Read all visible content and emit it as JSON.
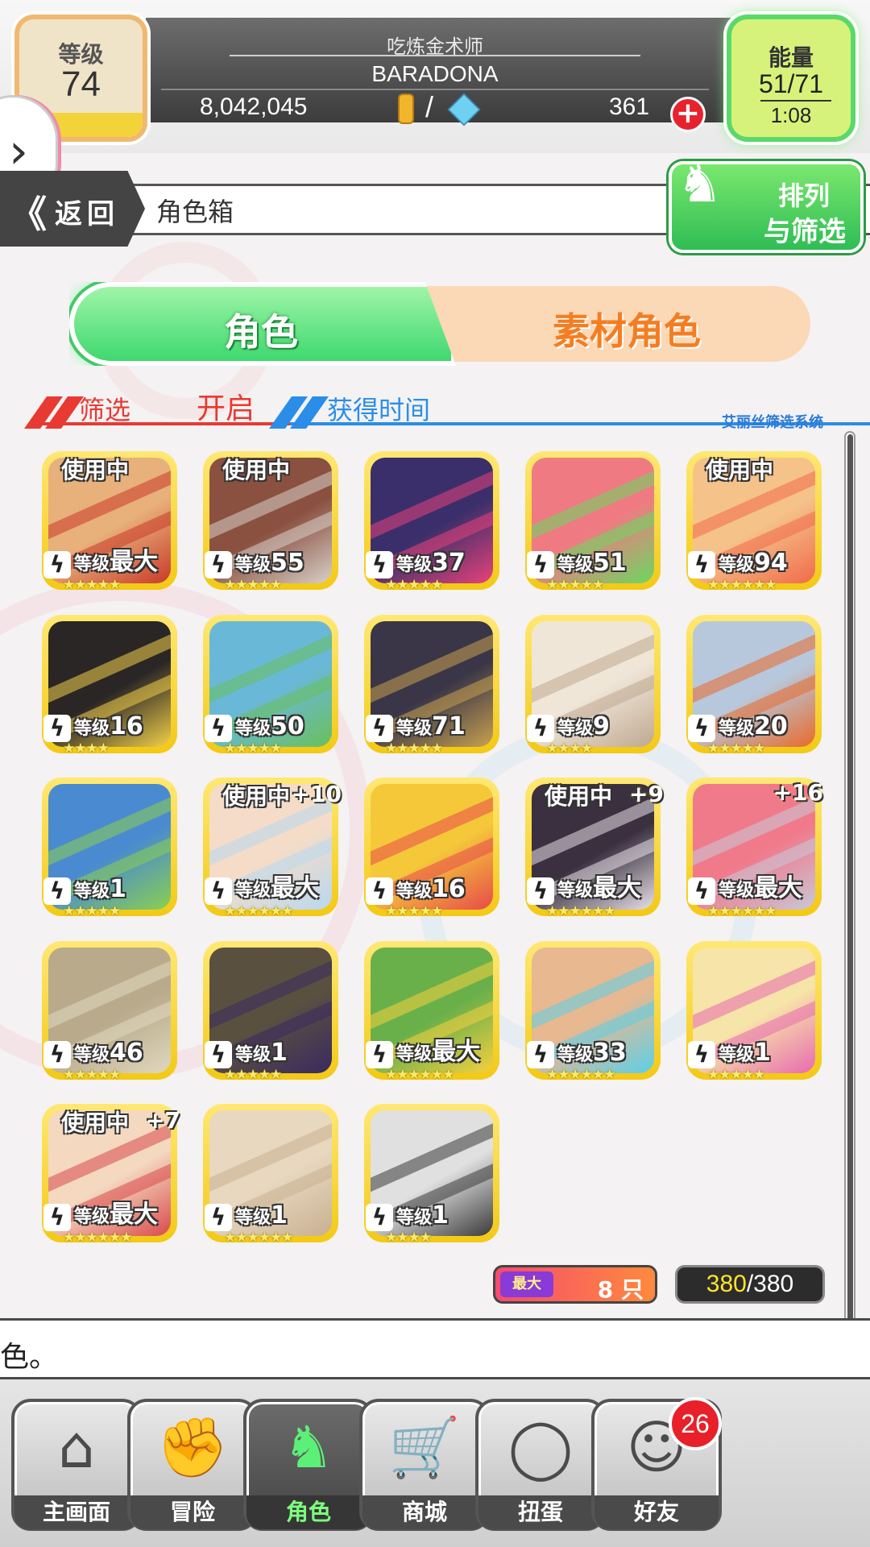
{
  "header": {
    "level_label": "等级",
    "level_value": "74",
    "title": "吃炼金术师",
    "player_name": "BARADONA",
    "gold": "8,042,045",
    "separator": "/",
    "gems": "361",
    "energy_label": "能量",
    "energy_value": "51/71",
    "energy_timer": "1:08",
    "add_icon": "plus-circle-icon"
  },
  "nav": {
    "back_label": "返回",
    "back_arrow": "《",
    "title": "角色箱",
    "sort_line1": "排列",
    "sort_line2": "与筛选"
  },
  "tabs": {
    "active": "角色",
    "inactive": "素材角色"
  },
  "filter": {
    "label": "筛选",
    "state": "开启",
    "sort_by": "获得时间",
    "system_name": "艾丽丝筛选系统"
  },
  "cards": [
    {
      "badge": "使用中",
      "level_prefix": "等级",
      "level": "最大",
      "stars": 5,
      "bg": "#e8b07a",
      "accent": "#c83a2a"
    },
    {
      "badge": "使用中",
      "level_prefix": "等级",
      "level": "55",
      "stars": 5,
      "bg": "#8a5040",
      "accent": "#d8d0c8"
    },
    {
      "badge": "",
      "level_prefix": "等级",
      "level": "37",
      "stars": 5,
      "bg": "#3a2f6a",
      "accent": "#e8427a"
    },
    {
      "badge": "",
      "level_prefix": "等级",
      "level": "51",
      "stars": 5,
      "bg": "#f07a82",
      "accent": "#6ad860"
    },
    {
      "badge": "使用中",
      "level_prefix": "等级",
      "level": "94",
      "stars": 6,
      "bg": "#f5c28a",
      "accent": "#f06a4a"
    },
    {
      "badge": "",
      "level_prefix": "等级",
      "level": "16",
      "stars": 4,
      "bg": "#2a2626",
      "accent": "#f2d04a"
    },
    {
      "badge": "",
      "level_prefix": "等级",
      "level": "50",
      "stars": 5,
      "bg": "#6ab8d8",
      "accent": "#6ac05a"
    },
    {
      "badge": "",
      "level_prefix": "等级",
      "level": "71",
      "stars": 5,
      "bg": "#3a3648",
      "accent": "#c8a050"
    },
    {
      "badge": "",
      "level_prefix": "等级",
      "level": "9",
      "stars": 4,
      "bg": "#efe6d8",
      "accent": "#c0a890"
    },
    {
      "badge": "",
      "level_prefix": "等级",
      "level": "20",
      "stars": 5,
      "bg": "#b8c8dc",
      "accent": "#e86a2a"
    },
    {
      "badge": "",
      "level_prefix": "等级",
      "level": "1",
      "stars": 5,
      "bg": "#4a8ad0",
      "accent": "#8ad050"
    },
    {
      "badge": "使用中",
      "plus": "+10",
      "level_prefix": "等级",
      "level": "最大",
      "stars": 6,
      "bg": "#f4dcc8",
      "accent": "#b8d8f0"
    },
    {
      "badge": "",
      "level_prefix": "等级",
      "level": "16",
      "stars": 5,
      "bg": "#f5c83a",
      "accent": "#e84a4a"
    },
    {
      "badge": "使用中",
      "plus": "+9",
      "level_prefix": "等级",
      "level": "最大",
      "stars": 6,
      "bg": "#3a3040",
      "accent": "#e8e0e8"
    },
    {
      "badge": "",
      "plus": "+16",
      "level_prefix": "等级",
      "level": "最大",
      "stars": 6,
      "bg": "#f07a8a",
      "accent": "#c8c8d8"
    },
    {
      "badge": "",
      "level_prefix": "等级",
      "level": "46",
      "stars": 5,
      "bg": "#b8aa8a",
      "accent": "#e0d8c0"
    },
    {
      "badge": "",
      "level_prefix": "等级",
      "level": "1",
      "stars": 5,
      "bg": "#5a5040",
      "accent": "#3a2a60"
    },
    {
      "badge": "",
      "level_prefix": "等级",
      "level": "最大",
      "stars": 6,
      "bg": "#6ab04a",
      "accent": "#f5d040"
    },
    {
      "badge": "",
      "level_prefix": "等级",
      "level": "33",
      "stars": 6,
      "bg": "#e8b890",
      "accent": "#5ad0e8"
    },
    {
      "badge": "",
      "level_prefix": "等级",
      "level": "1",
      "stars": 5,
      "bg": "#f7e4a8",
      "accent": "#e86ab0"
    },
    {
      "badge": "使用中",
      "plus": "+7",
      "level_prefix": "等级",
      "level": "最大",
      "stars": 6,
      "bg": "#f4d8c0",
      "accent": "#d84a4a"
    },
    {
      "badge": "",
      "level_prefix": "等级",
      "level": "1",
      "stars": 6,
      "bg": "#e8d8c0",
      "accent": "#c8b090"
    },
    {
      "badge": "",
      "level_prefix": "等级",
      "level": "1",
      "stars": 4,
      "bg": "#e0e0e0",
      "accent": "#3a3a3a"
    }
  ],
  "counts": {
    "max_label": "最大",
    "max_count": "8 只",
    "used": "380",
    "total": "380"
  },
  "message": "色。",
  "bottom_nav": [
    {
      "label": "主画面",
      "icon": "home-icon",
      "glyph": "⌂"
    },
    {
      "label": "冒险",
      "icon": "handshake-icon",
      "glyph": "✊"
    },
    {
      "label": "角色",
      "icon": "bunny-icon",
      "glyph": "♞"
    },
    {
      "label": "商城",
      "icon": "cart-icon",
      "glyph": "🛒"
    },
    {
      "label": "扭蛋",
      "icon": "egg-icon",
      "glyph": "◯"
    },
    {
      "label": "好友",
      "icon": "friends-icon",
      "glyph": "☺"
    }
  ],
  "gacha_badge": "26",
  "colors": {
    "green_accent": "#3fd86f",
    "orange_accent": "#f57d21",
    "card_gold": "#f3c915"
  }
}
